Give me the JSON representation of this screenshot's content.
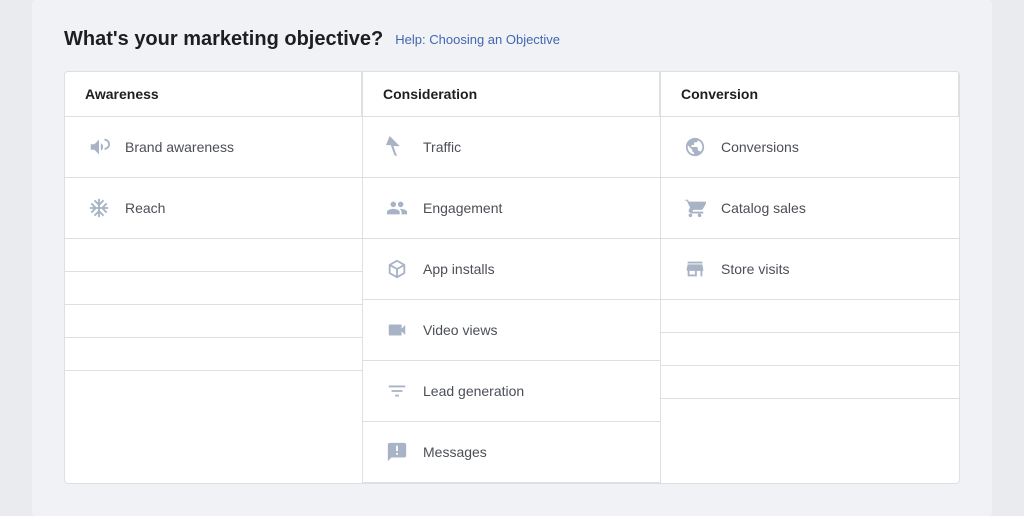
{
  "page": {
    "title": "What's your marketing objective?",
    "help_link": "Help: Choosing an Objective"
  },
  "columns": [
    {
      "id": "awareness",
      "header": "Awareness",
      "items": [
        {
          "id": "brand-awareness",
          "label": "Brand awareness",
          "icon": "megaphone"
        },
        {
          "id": "reach",
          "label": "Reach",
          "icon": "snowflake"
        }
      ]
    },
    {
      "id": "consideration",
      "header": "Consideration",
      "items": [
        {
          "id": "traffic",
          "label": "Traffic",
          "icon": "cursor"
        },
        {
          "id": "engagement",
          "label": "Engagement",
          "icon": "people"
        },
        {
          "id": "app-installs",
          "label": "App installs",
          "icon": "box"
        },
        {
          "id": "video-views",
          "label": "Video views",
          "icon": "video"
        },
        {
          "id": "lead-generation",
          "label": "Lead generation",
          "icon": "funnel"
        },
        {
          "id": "messages",
          "label": "Messages",
          "icon": "speech"
        }
      ]
    },
    {
      "id": "conversion",
      "header": "Conversion",
      "items": [
        {
          "id": "conversions",
          "label": "Conversions",
          "icon": "globe"
        },
        {
          "id": "catalog-sales",
          "label": "Catalog sales",
          "icon": "cart"
        },
        {
          "id": "store-visits",
          "label": "Store visits",
          "icon": "store"
        }
      ]
    }
  ]
}
